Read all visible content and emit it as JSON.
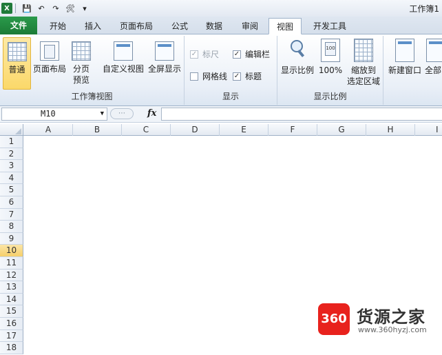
{
  "app": {
    "logo_letter": "X",
    "title": "工作簿1"
  },
  "qat": {
    "save": "💾",
    "undo": "↶",
    "redo": "↷",
    "tools": "🛠",
    "more": "▾"
  },
  "tabs": [
    {
      "label": "文件"
    },
    {
      "label": "开始"
    },
    {
      "label": "插入"
    },
    {
      "label": "页面布局"
    },
    {
      "label": "公式"
    },
    {
      "label": "数据"
    },
    {
      "label": "审阅"
    },
    {
      "label": "视图"
    },
    {
      "label": "开发工具"
    }
  ],
  "ribbon": {
    "workbook_views": {
      "label": "工作簿视图",
      "normal": "普通",
      "page_layout": "页面布局",
      "page_break_1": "分页",
      "page_break_2": "预览",
      "custom_views": "自定义视图",
      "full_screen": "全屏显示"
    },
    "show": {
      "label": "显示",
      "ruler": {
        "label": "标尺",
        "checked": true,
        "disabled": true
      },
      "gridlines": {
        "label": "网格线",
        "checked": false
      },
      "formula_bar": {
        "label": "编辑栏",
        "checked": true
      },
      "headings": {
        "label": "标题",
        "checked": true
      },
      "check_mark": "✓"
    },
    "zoom": {
      "label": "显示比例",
      "zoom": "显示比例",
      "hundred": "100%",
      "zoom_sel_1": "缩放到",
      "zoom_sel_2": "选定区域"
    },
    "window": {
      "new_window": "新建窗口",
      "arrange_all": "全部"
    }
  },
  "formula_bar": {
    "name_box": "M10",
    "dropdown": "▼",
    "dots": "⋯",
    "fx": "fx",
    "value": ""
  },
  "grid": {
    "columns": [
      "A",
      "B",
      "C",
      "D",
      "E",
      "F",
      "G",
      "H",
      "I"
    ],
    "rows": [
      "1",
      "2",
      "3",
      "4",
      "5",
      "6",
      "7",
      "8",
      "9",
      "10",
      "11",
      "12",
      "13",
      "14",
      "15",
      "16",
      "17",
      "18"
    ],
    "active_row": "10"
  },
  "watermark": {
    "badge": "360",
    "name": "货源之家",
    "url": "www.360hyzj.com"
  }
}
